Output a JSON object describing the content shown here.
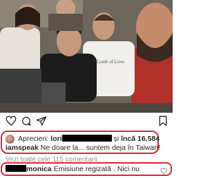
{
  "post": {
    "likes_prefix": "Aprecieri:",
    "liker": "lori",
    "likes_and": "și",
    "likes_more": "încă 16.584",
    "caption_user": "iamspeak",
    "caption_text": "Ne doare la... suntem deja în Taiwan!",
    "view_comments": "Vezi toate cele 115 comentarii",
    "comment_user": "monica",
    "comment_text": "Emisiune regizată . Nici nu"
  },
  "photo": {
    "shirt_text": "Lamb of Love"
  },
  "icons": [
    "heart-icon",
    "comment-icon",
    "share-icon",
    "bookmark-icon",
    "small-heart-icon"
  ],
  "colors": {
    "highlight": "#e0242c",
    "muted": "#8e8e8e"
  }
}
